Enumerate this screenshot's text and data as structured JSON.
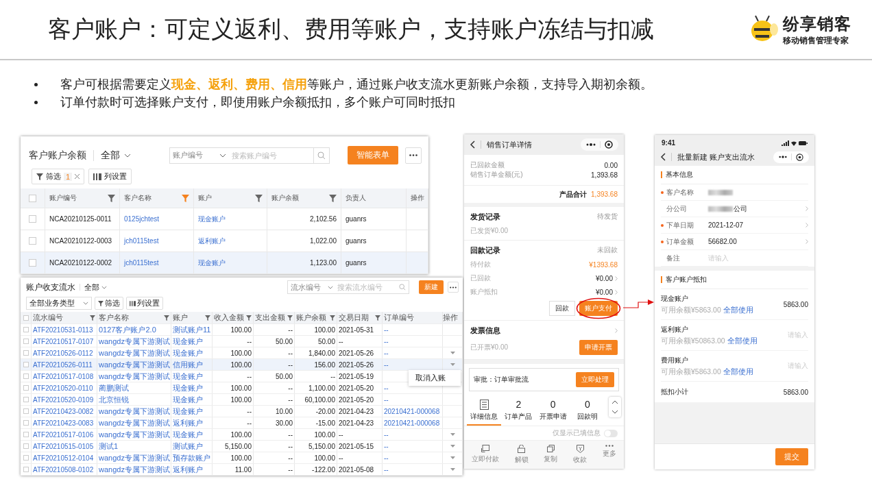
{
  "slide": {
    "title": "客户账户：可定义返利、费用等账户，支持账户冻结与扣减",
    "brand": {
      "name": "纷享销客",
      "tagline": "移动销售管理专家"
    },
    "bullets": [
      "客户可根据需要定义**现金、返利、费用、信用**等账户，通过账户收支流水更新账户余额，支持导入期初余额。",
      "订单付款时可选择账户支付，即使用账户余额抵扣，多个账户可同时抵扣"
    ]
  },
  "balance_table": {
    "title": "客户账户余额",
    "view": "全部",
    "search": {
      "scope": "账户编号",
      "placeholder": "搜索账户编号"
    },
    "primary_button": "智能表单",
    "filter": {
      "label": "筛选",
      "count": "1"
    },
    "column_settings": "列设置",
    "all_checked": false,
    "columns": [
      {
        "label": "账户编号",
        "filter": true,
        "filter_active": false
      },
      {
        "label": "客户名称",
        "filter": true,
        "filter_active": true
      },
      {
        "label": "账户",
        "filter": true,
        "filter_active": false
      },
      {
        "label": "账户余额",
        "filter": true,
        "filter_active": false
      },
      {
        "label": "负责人",
        "filter": false
      },
      {
        "label": "操作"
      }
    ],
    "rows": [
      {
        "account_no": "NCA20210125-0011",
        "customer": "0125jchtest",
        "account": "现金账户",
        "balance": "2,102.56",
        "owner": "guanrs",
        "checked": false,
        "highlighted": false
      },
      {
        "account_no": "NCA20210122-0003",
        "customer": "jch0115test",
        "account": "返利账户",
        "balance": "1,022.00",
        "owner": "guanrs",
        "checked": false,
        "highlighted": false
      },
      {
        "account_no": "NCA20210122-0002",
        "customer": "jch0115test",
        "account": "现金账户",
        "balance": "1,123.00",
        "owner": "guanrs",
        "checked": false,
        "highlighted": true
      }
    ]
  },
  "flow_table": {
    "title": "账户收支流水",
    "view": "全部",
    "search": {
      "scope": "流水编号",
      "placeholder": "搜索流水编号"
    },
    "primary_button": "新建",
    "type_filter": "全部业务类型",
    "filter": "筛选",
    "column_settings": "列设置",
    "all_checked": false,
    "columns": [
      {
        "label": "流水编号",
        "filter": true
      },
      {
        "label": "客户名称",
        "filter": true
      },
      {
        "label": "账户",
        "filter": true
      },
      {
        "label": "收入金额",
        "filter": true
      },
      {
        "label": "支出金额",
        "filter": true
      },
      {
        "label": "账户余额",
        "filter": true
      },
      {
        "label": "交易日期",
        "filter": true
      },
      {
        "label": "订单编号",
        "filter": false
      },
      {
        "label": "操作",
        "filter": false
      }
    ],
    "rows": [
      {
        "no": "ATF20210531-0113",
        "customer": "0127客户账户2.0",
        "account": "测试账户11",
        "income": "100.00",
        "expense": "--",
        "balance": "100.00",
        "date": "2021-05-31",
        "order": "--",
        "action": false,
        "checked": false,
        "highlighted": false
      },
      {
        "no": "ATF20210517-0107",
        "customer": "wangdz专属下游测试",
        "account": "现金账户",
        "income": "--",
        "expense": "50.00",
        "balance": "50.00",
        "date": "--",
        "order": "--",
        "action": false,
        "checked": false,
        "highlighted": false
      },
      {
        "no": "ATF20210526-0112",
        "customer": "wangdz专属下游测试",
        "account": "现金账户",
        "income": "100.00",
        "expense": "--",
        "balance": "1,840.00",
        "date": "2021-05-26",
        "order": "--",
        "action": true,
        "checked": false,
        "highlighted": false
      },
      {
        "no": "ATF20210526-0111",
        "customer": "wangdz专属下游测试",
        "account": "信用账户",
        "income": "100.00",
        "expense": "--",
        "balance": "156.00",
        "date": "2021-05-26",
        "order": "--",
        "action": true,
        "checked": false,
        "highlighted": true,
        "menu": [
          "取消入账"
        ]
      },
      {
        "no": "ATF20210517-0108",
        "customer": "wangdz专属下游测试",
        "account": "现金账户",
        "income": "--",
        "expense": "50.00",
        "balance": "--",
        "date": "2021-05-19",
        "checked": false,
        "highlighted": false
      },
      {
        "no": "ATF20210520-0110",
        "customer": "蔺鹏测试",
        "account": "现金账户",
        "income": "100.00",
        "expense": "--",
        "balance": "1,100.00",
        "date": "2021-05-20",
        "order": "--",
        "action": false,
        "checked": false,
        "highlighted": false
      },
      {
        "no": "ATF20210520-0109",
        "customer": "北京恒锐",
        "account": "现金账户",
        "income": "100.00",
        "expense": "--",
        "balance": "60,100.00",
        "date": "2021-05-20",
        "order": "--",
        "action": false,
        "checked": false,
        "highlighted": false
      },
      {
        "no": "ATF20210423-0082",
        "customer": "wangdz专属下游测试",
        "account": "现金账户",
        "income": "--",
        "expense": "10.00",
        "balance": "-20.00",
        "date": "2021-04-23",
        "order": "20210421-000068",
        "action": false,
        "checked": false,
        "highlighted": false
      },
      {
        "no": "ATF20210423-0083",
        "customer": "wangdz专属下游测试",
        "account": "返利账户",
        "income": "--",
        "expense": "30.00",
        "balance": "-15.00",
        "date": "2021-04-23",
        "order": "20210421-000068",
        "action": false,
        "checked": false,
        "highlighted": false
      },
      {
        "no": "ATF20210517-0106",
        "customer": "wangdz专属下游测试",
        "account": "现金账户",
        "income": "100.00",
        "expense": "--",
        "balance": "100.00",
        "date": "--",
        "order": "--",
        "action": true,
        "checked": false,
        "highlighted": false
      },
      {
        "no": "ATF20210515-0105",
        "customer": "测试1",
        "account": "测试账户",
        "income": "5,150.00",
        "expense": "--",
        "balance": "5,150.00",
        "date": "2021-05-15",
        "order": "--",
        "action": true,
        "checked": false,
        "highlighted": false
      },
      {
        "no": "ATF20210512-0104",
        "customer": "wangdz专属下游测试",
        "account": "预存款账户",
        "income": "100.00",
        "expense": "--",
        "balance": "100.00",
        "date": "--",
        "order": "--",
        "action": true,
        "checked": false,
        "highlighted": false
      },
      {
        "no": "ATF20210508-0102",
        "customer": "wangdz专属下游测试",
        "account": "返利账户",
        "income": "11.00",
        "expense": "--",
        "balance": "-122.00",
        "date": "2021-05-08",
        "order": "--",
        "action": true,
        "checked": false,
        "highlighted": false
      }
    ]
  },
  "order_phone": {
    "title": "销售订单详情",
    "summary": [
      {
        "label": "已回款金额",
        "value": "0.00"
      },
      {
        "label": "销售订单金额(元)",
        "value": "1,393.68"
      }
    ],
    "total": {
      "label": "产品合计",
      "value": "1,393.68"
    },
    "shipping": {
      "title": "发货记录",
      "status": "待发货",
      "note": "已发货¥0.00"
    },
    "payment": {
      "title": "回款记录",
      "status": "未回款",
      "lines": [
        {
          "label": "待付款",
          "value": "¥1393.68",
          "highlight": true,
          "link": false
        },
        {
          "label": "已回款",
          "value": "¥0.00",
          "highlight": false,
          "link": true
        },
        {
          "label": "账户抵扣",
          "value": "¥0.00",
          "highlight": false,
          "link": true
        }
      ],
      "buttons": [
        {
          "label": "回款",
          "primary": false,
          "circled": false
        },
        {
          "label": "账户支付",
          "primary": true,
          "circled": true
        }
      ]
    },
    "invoice": {
      "title": "发票信息",
      "note": "已开票¥0.00",
      "button": "申请开票"
    },
    "approval": {
      "label": "审批：订单审批流",
      "button": "立即处理"
    },
    "tabs": [
      {
        "kind": "icon",
        "label": "详细信息",
        "selected": true
      },
      {
        "kind": "count",
        "count": "2",
        "label": "订单产品",
        "selected": false
      },
      {
        "kind": "count",
        "count": "0",
        "label": "开票申请",
        "selected": false
      },
      {
        "kind": "count",
        "count": "0",
        "label": "回款明",
        "selected": false
      }
    ],
    "toggle": {
      "label": "仅显示已填信息",
      "on": false
    },
    "actions": [
      {
        "label": "立即付款"
      },
      {
        "label": "解锁"
      },
      {
        "label": "复制"
      },
      {
        "label": "收款"
      },
      {
        "label": "更多"
      }
    ]
  },
  "expense_phone": {
    "time": "9:41",
    "title": "批量新建 账户支出流水",
    "basic": {
      "title": "基本信息",
      "fields": [
        {
          "label": "客户名称",
          "required": true,
          "redacted": true,
          "arrow": false
        },
        {
          "label": "分公司",
          "required": false,
          "redacted": true,
          "value": "公司",
          "arrow": true
        },
        {
          "label": "下单日期",
          "required": true,
          "redacted": false,
          "value": "2021-12-07",
          "arrow": true
        },
        {
          "label": "订单金额",
          "required": true,
          "redacted": false,
          "value": "56682.00",
          "arrow": true
        },
        {
          "label": "备注",
          "required": false,
          "redacted": false,
          "placeholder": "请输入",
          "arrow": false
        }
      ]
    },
    "deduction": {
      "title": "客户账户抵扣",
      "accounts": [
        {
          "name": "现金账户",
          "available": "可用余额¥5863.00",
          "use_all": "全部使用",
          "value": "5863.00"
        },
        {
          "name": "返利账户",
          "available": "可用余额¥50863.00",
          "use_all": "全部使用",
          "placeholder": "请输入"
        },
        {
          "name": "费用账户",
          "available": "可用余额¥5863.00",
          "use_all": "全部使用",
          "placeholder": "请输入"
        }
      ],
      "subtotal": {
        "label": "抵扣小计",
        "value": "5863.00"
      }
    },
    "submit": "提交"
  }
}
